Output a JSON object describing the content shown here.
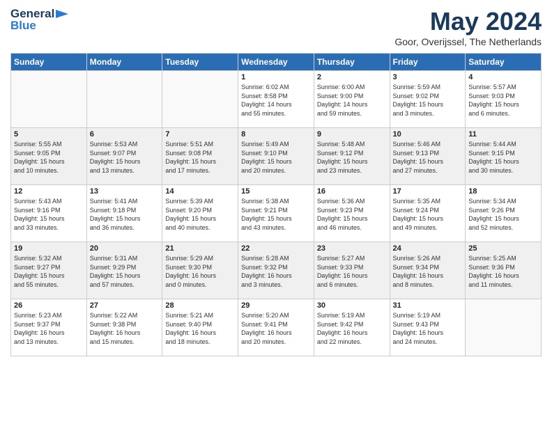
{
  "header": {
    "logo_line1": "General",
    "logo_line2": "Blue",
    "month": "May 2024",
    "location": "Goor, Overijssel, The Netherlands"
  },
  "weekdays": [
    "Sunday",
    "Monday",
    "Tuesday",
    "Wednesday",
    "Thursday",
    "Friday",
    "Saturday"
  ],
  "weeks": [
    [
      {
        "day": "",
        "info": ""
      },
      {
        "day": "",
        "info": ""
      },
      {
        "day": "",
        "info": ""
      },
      {
        "day": "1",
        "info": "Sunrise: 6:02 AM\nSunset: 8:58 PM\nDaylight: 14 hours\nand 55 minutes."
      },
      {
        "day": "2",
        "info": "Sunrise: 6:00 AM\nSunset: 9:00 PM\nDaylight: 14 hours\nand 59 minutes."
      },
      {
        "day": "3",
        "info": "Sunrise: 5:59 AM\nSunset: 9:02 PM\nDaylight: 15 hours\nand 3 minutes."
      },
      {
        "day": "4",
        "info": "Sunrise: 5:57 AM\nSunset: 9:03 PM\nDaylight: 15 hours\nand 6 minutes."
      }
    ],
    [
      {
        "day": "5",
        "info": "Sunrise: 5:55 AM\nSunset: 9:05 PM\nDaylight: 15 hours\nand 10 minutes."
      },
      {
        "day": "6",
        "info": "Sunrise: 5:53 AM\nSunset: 9:07 PM\nDaylight: 15 hours\nand 13 minutes."
      },
      {
        "day": "7",
        "info": "Sunrise: 5:51 AM\nSunset: 9:08 PM\nDaylight: 15 hours\nand 17 minutes."
      },
      {
        "day": "8",
        "info": "Sunrise: 5:49 AM\nSunset: 9:10 PM\nDaylight: 15 hours\nand 20 minutes."
      },
      {
        "day": "9",
        "info": "Sunrise: 5:48 AM\nSunset: 9:12 PM\nDaylight: 15 hours\nand 23 minutes."
      },
      {
        "day": "10",
        "info": "Sunrise: 5:46 AM\nSunset: 9:13 PM\nDaylight: 15 hours\nand 27 minutes."
      },
      {
        "day": "11",
        "info": "Sunrise: 5:44 AM\nSunset: 9:15 PM\nDaylight: 15 hours\nand 30 minutes."
      }
    ],
    [
      {
        "day": "12",
        "info": "Sunrise: 5:43 AM\nSunset: 9:16 PM\nDaylight: 15 hours\nand 33 minutes."
      },
      {
        "day": "13",
        "info": "Sunrise: 5:41 AM\nSunset: 9:18 PM\nDaylight: 15 hours\nand 36 minutes."
      },
      {
        "day": "14",
        "info": "Sunrise: 5:39 AM\nSunset: 9:20 PM\nDaylight: 15 hours\nand 40 minutes."
      },
      {
        "day": "15",
        "info": "Sunrise: 5:38 AM\nSunset: 9:21 PM\nDaylight: 15 hours\nand 43 minutes."
      },
      {
        "day": "16",
        "info": "Sunrise: 5:36 AM\nSunset: 9:23 PM\nDaylight: 15 hours\nand 46 minutes."
      },
      {
        "day": "17",
        "info": "Sunrise: 5:35 AM\nSunset: 9:24 PM\nDaylight: 15 hours\nand 49 minutes."
      },
      {
        "day": "18",
        "info": "Sunrise: 5:34 AM\nSunset: 9:26 PM\nDaylight: 15 hours\nand 52 minutes."
      }
    ],
    [
      {
        "day": "19",
        "info": "Sunrise: 5:32 AM\nSunset: 9:27 PM\nDaylight: 15 hours\nand 55 minutes."
      },
      {
        "day": "20",
        "info": "Sunrise: 5:31 AM\nSunset: 9:29 PM\nDaylight: 15 hours\nand 57 minutes."
      },
      {
        "day": "21",
        "info": "Sunrise: 5:29 AM\nSunset: 9:30 PM\nDaylight: 16 hours\nand 0 minutes."
      },
      {
        "day": "22",
        "info": "Sunrise: 5:28 AM\nSunset: 9:32 PM\nDaylight: 16 hours\nand 3 minutes."
      },
      {
        "day": "23",
        "info": "Sunrise: 5:27 AM\nSunset: 9:33 PM\nDaylight: 16 hours\nand 6 minutes."
      },
      {
        "day": "24",
        "info": "Sunrise: 5:26 AM\nSunset: 9:34 PM\nDaylight: 16 hours\nand 8 minutes."
      },
      {
        "day": "25",
        "info": "Sunrise: 5:25 AM\nSunset: 9:36 PM\nDaylight: 16 hours\nand 11 minutes."
      }
    ],
    [
      {
        "day": "26",
        "info": "Sunrise: 5:23 AM\nSunset: 9:37 PM\nDaylight: 16 hours\nand 13 minutes."
      },
      {
        "day": "27",
        "info": "Sunrise: 5:22 AM\nSunset: 9:38 PM\nDaylight: 16 hours\nand 15 minutes."
      },
      {
        "day": "28",
        "info": "Sunrise: 5:21 AM\nSunset: 9:40 PM\nDaylight: 16 hours\nand 18 minutes."
      },
      {
        "day": "29",
        "info": "Sunrise: 5:20 AM\nSunset: 9:41 PM\nDaylight: 16 hours\nand 20 minutes."
      },
      {
        "day": "30",
        "info": "Sunrise: 5:19 AM\nSunset: 9:42 PM\nDaylight: 16 hours\nand 22 minutes."
      },
      {
        "day": "31",
        "info": "Sunrise: 5:19 AM\nSunset: 9:43 PM\nDaylight: 16 hours\nand 24 minutes."
      },
      {
        "day": "",
        "info": ""
      }
    ]
  ]
}
